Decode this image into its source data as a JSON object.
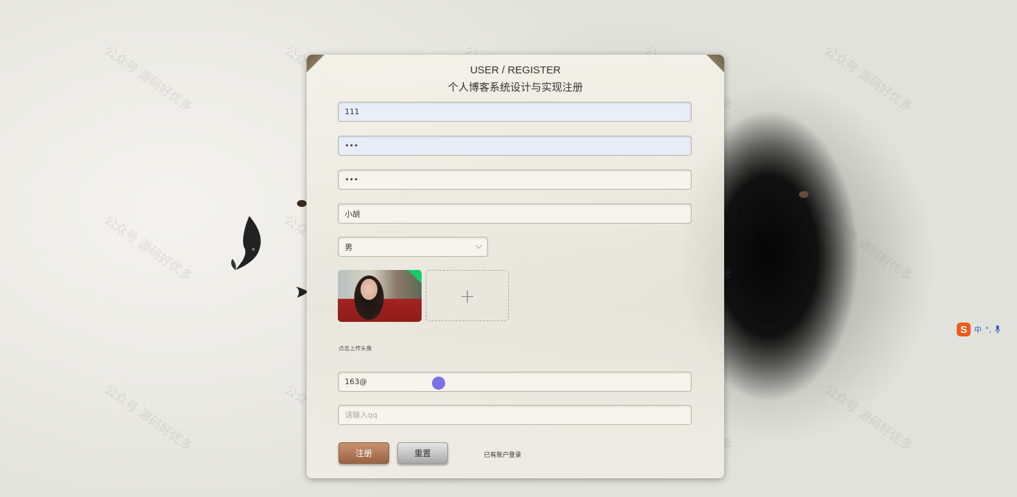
{
  "watermark_text": "公众号 源码好优多",
  "form": {
    "title_en": "USER / REGISTER",
    "title_cn": "个人博客系统设计与实现注册",
    "username_value": "111",
    "password_value": "•••",
    "confirm_password_value": "•••",
    "nickname_value": "小胡",
    "gender_selected": "男",
    "upload_plus": "+",
    "upload_tip": "点击上传头像",
    "email_value": "163@",
    "qq_placeholder": "请输入qq",
    "register_label": "注册",
    "reset_label": "重置",
    "login_link_label": "已有账户登录"
  },
  "ime": {
    "logo": "S",
    "mode": "中",
    "punct": "°,",
    "mic_icon": "mic-icon"
  },
  "colors": {
    "register_button": "#a86d4d",
    "reset_button": "#c4c4c4",
    "cursor_dot": "#7b72ea",
    "upload_success": "#13ce66"
  }
}
